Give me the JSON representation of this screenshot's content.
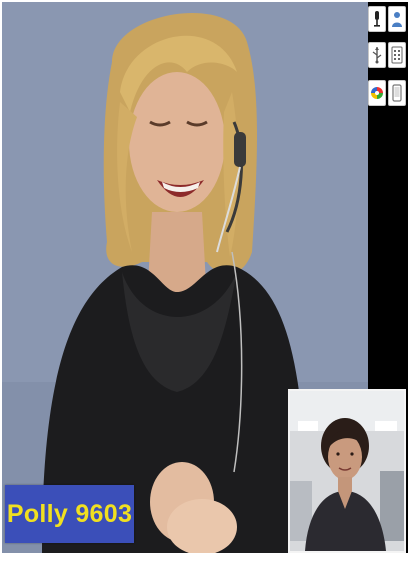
{
  "call": {
    "remote_participant": {
      "name_label": "Polly 9603",
      "badge_bg": "#3b4fb9",
      "badge_text_color": "#f0e020"
    }
  },
  "toolbar": {
    "buttons": [
      {
        "icon": "microphone-icon"
      },
      {
        "icon": "user-icon"
      },
      {
        "icon": "usb-icon"
      },
      {
        "icon": "keypad-icon"
      },
      {
        "icon": "color-wheel-icon"
      },
      {
        "icon": "device-icon"
      }
    ]
  },
  "colors": {
    "toolbar_bg": "#000000",
    "remote_background": "#8896b0"
  }
}
